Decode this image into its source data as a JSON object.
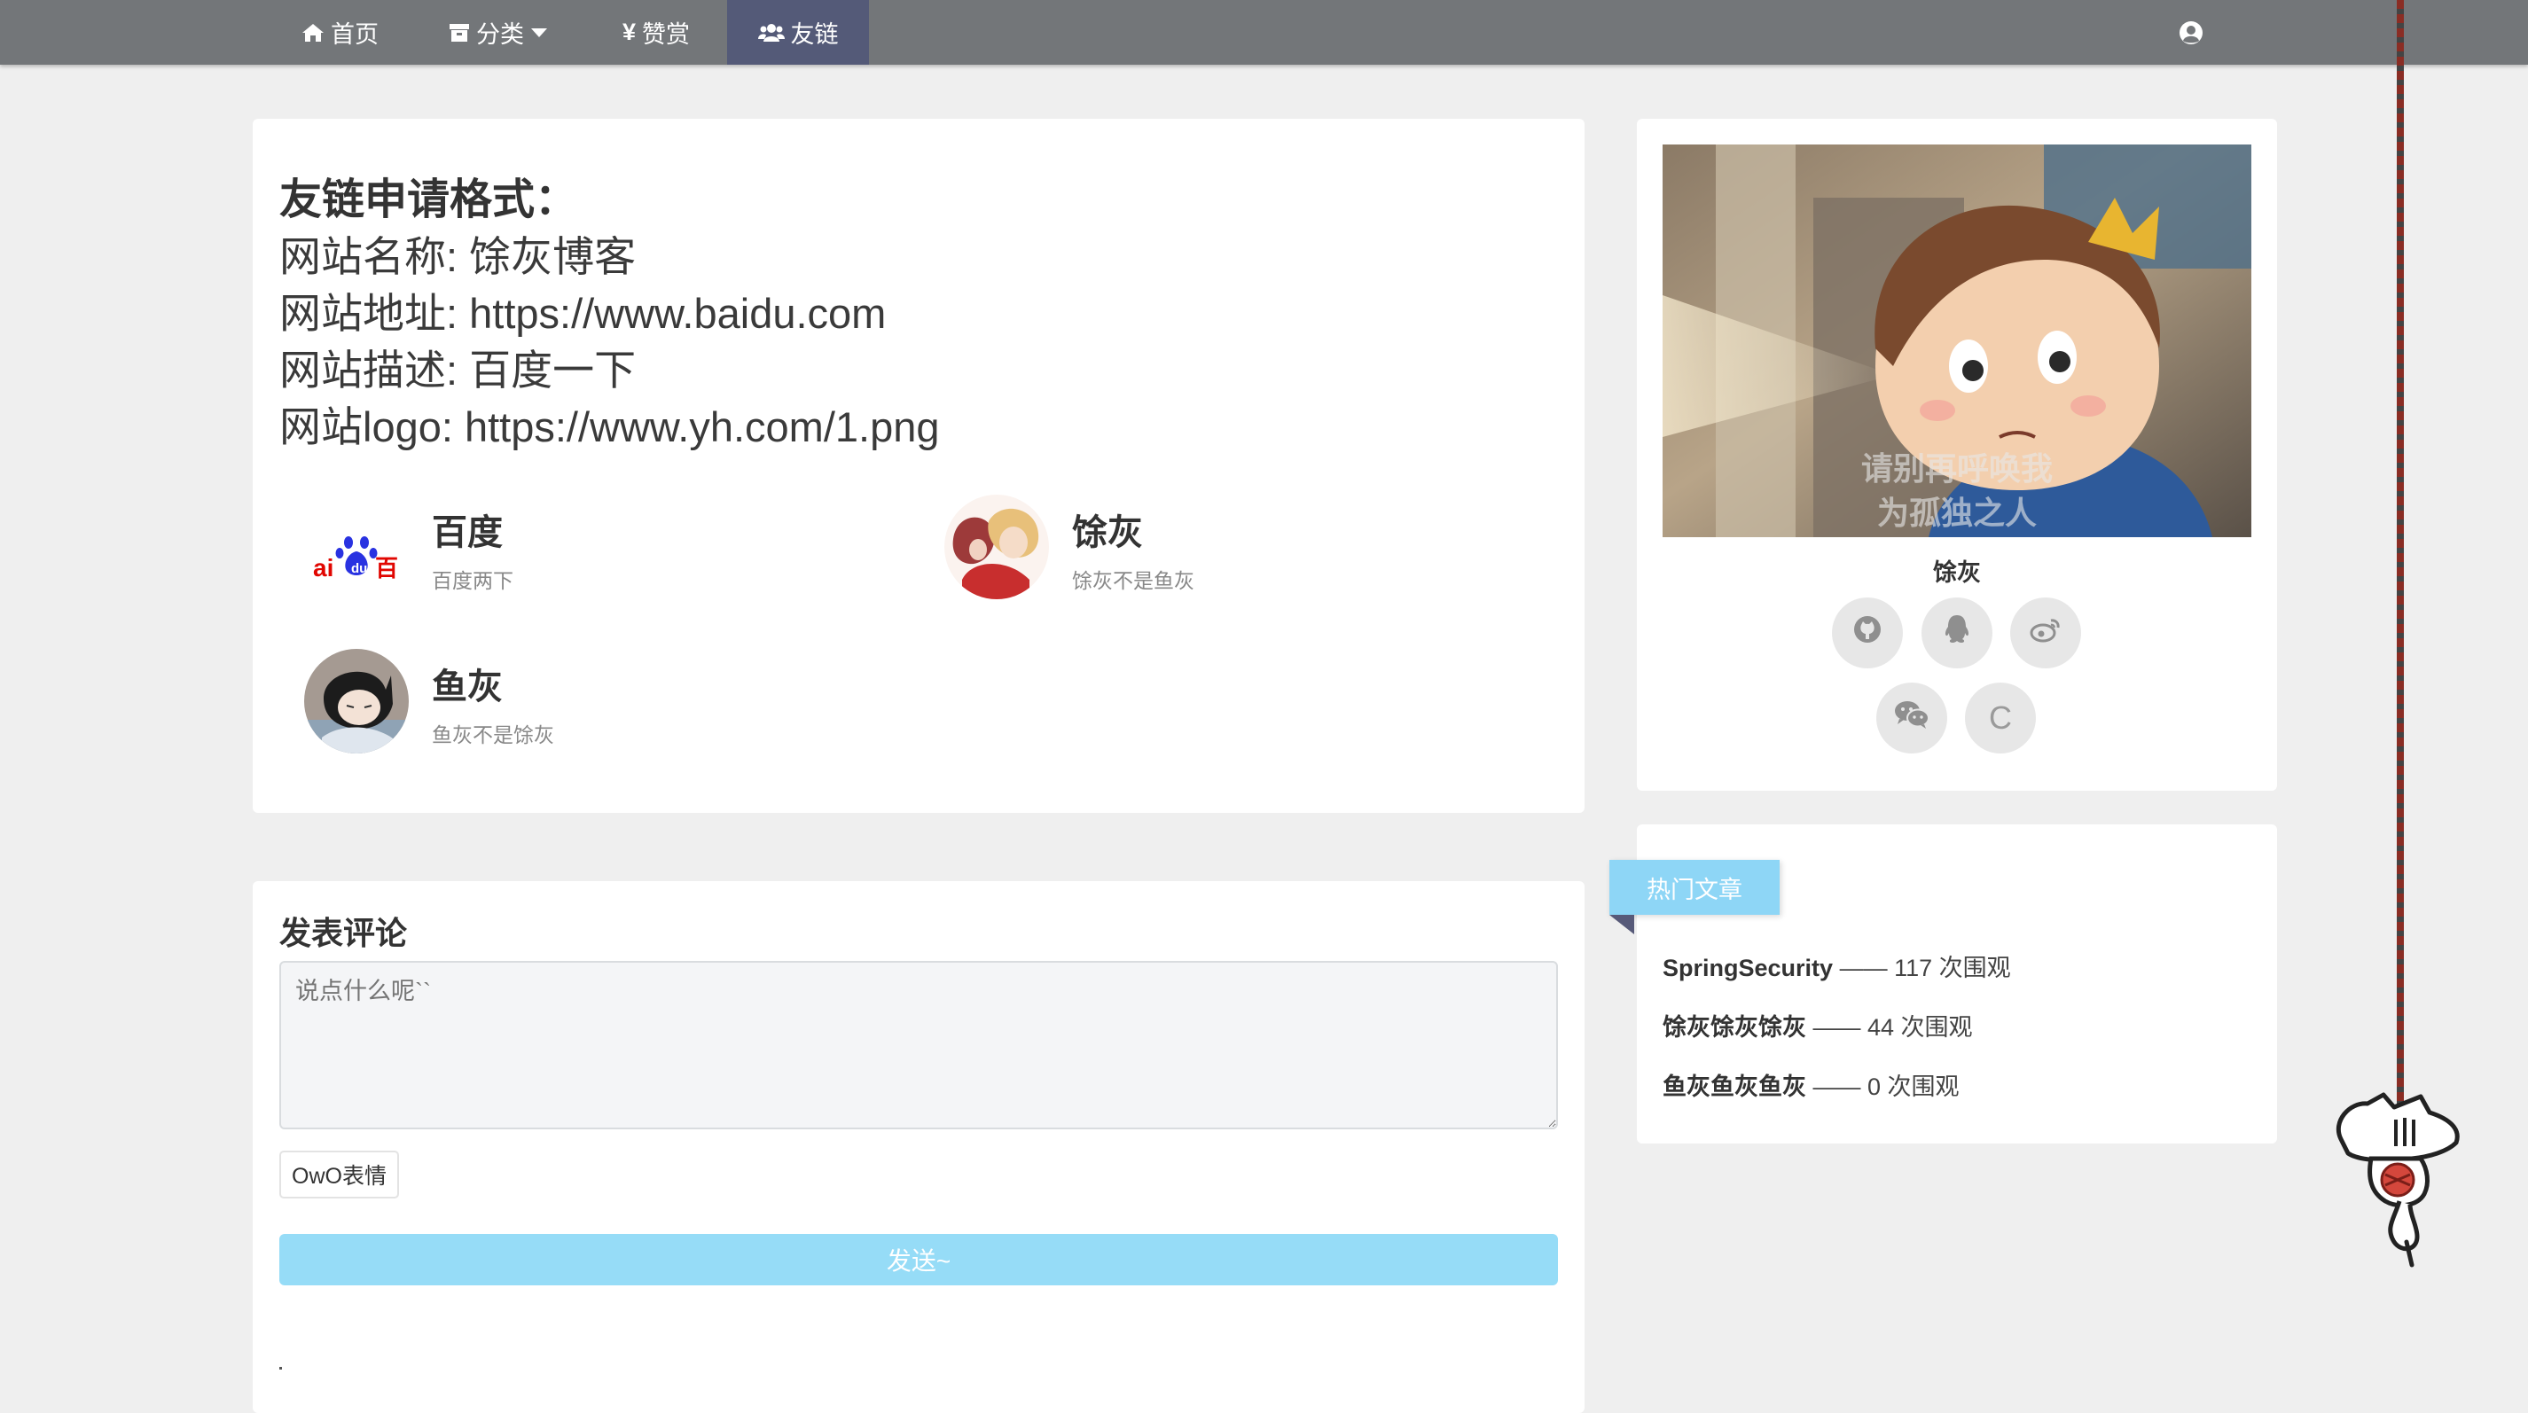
{
  "nav": {
    "home": "首页",
    "category": "分类",
    "reward": "赞赏",
    "friends": "友链"
  },
  "friends": {
    "format_title": "友链申请格式：",
    "format_lines": [
      "网站名称: 馀灰博客",
      "网站地址: https://www.baidu.com",
      "网站描述: 百度一下",
      "网站logo: https://www.yh.com/1.png"
    ],
    "links": [
      {
        "name": "百度",
        "desc": "百度两下"
      },
      {
        "name": "馀灰",
        "desc": "馀灰不是鱼灰"
      },
      {
        "name": "鱼灰",
        "desc": "鱼灰不是馀灰"
      }
    ],
    "baidu_logo_text": "百"
  },
  "comment": {
    "title": "发表评论",
    "placeholder": "说点什么呢``",
    "owo": "OwO表情",
    "send": "发送~"
  },
  "profile": {
    "banner_caption_1": "请别再呼唤我",
    "banner_caption_2": "为孤独之人",
    "name": "馀灰",
    "social": [
      "github-icon",
      "qq-icon",
      "weibo-icon",
      "wechat-icon",
      "csdn-icon"
    ],
    "csdn_label": "C"
  },
  "hot": {
    "title": "热门文章",
    "posts": [
      {
        "title": "SpringSecurity",
        "views": "—— 117 次围观"
      },
      {
        "title": "馀灰馀灰馀灰",
        "views": "—— 44 次围观"
      },
      {
        "title": "鱼灰鱼灰鱼灰",
        "views": "—— 0 次围观"
      }
    ]
  },
  "colors": {
    "nav_bg": "#737679",
    "nav_active": "#545a78",
    "accent": "#8ed6f6",
    "send_button": "#96dcf7"
  }
}
